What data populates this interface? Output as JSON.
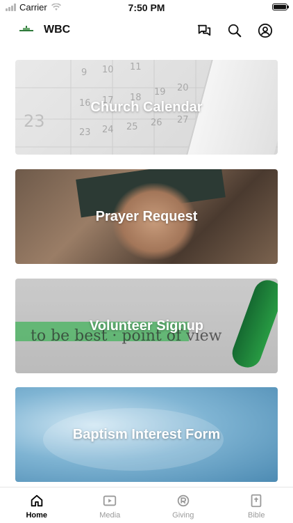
{
  "status": {
    "carrier": "Carrier",
    "time": "7:50 PM"
  },
  "header": {
    "brand": "WBC",
    "icons": [
      "chat-icon",
      "search-icon",
      "account-icon"
    ]
  },
  "cards": [
    {
      "title": "Church Calendar"
    },
    {
      "title": "Prayer Request"
    },
    {
      "title": "Volunteer Signup"
    },
    {
      "title": "Baptism Interest Form"
    }
  ],
  "tabs": [
    {
      "label": "Home",
      "icon": "home-icon",
      "active": true
    },
    {
      "label": "Media",
      "icon": "media-icon",
      "active": false
    },
    {
      "label": "Giving",
      "icon": "giving-icon",
      "active": false
    },
    {
      "label": "Bible",
      "icon": "bible-icon",
      "active": false
    }
  ],
  "colors": {
    "accent": "#000000",
    "inactive": "#9a9a9a"
  }
}
